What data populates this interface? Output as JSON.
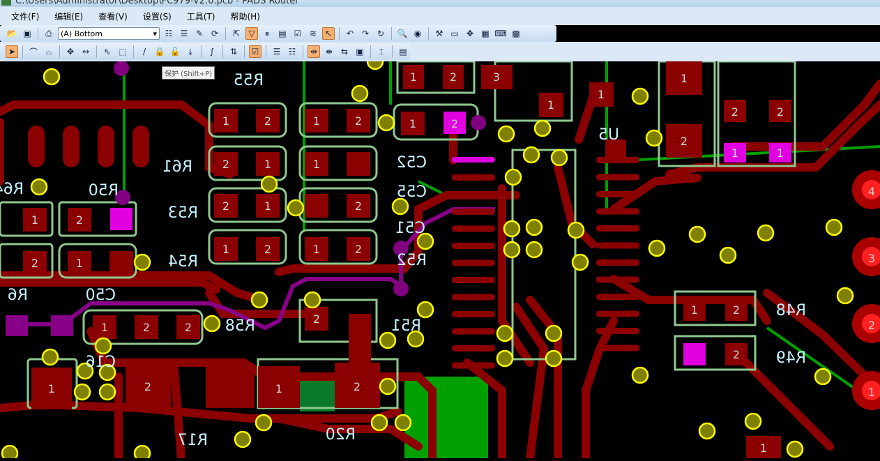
{
  "window": {
    "title": "C:\\Users\\Administrator\\Desktop\\FC979-V2.0.pcb  - PADS Router"
  },
  "menu": [
    "文件(F)",
    "编辑(E)",
    "查看(V)",
    "设置(S)",
    "工具(T)",
    "帮助(H)"
  ],
  "toolbar": {
    "layer_select": "(A) Bottom",
    "tooltip": "保护 (Shift+P)"
  },
  "silk": {
    "r55": "R55",
    "r61": "R61",
    "r50": "R50",
    "r53": "R53",
    "r54": "R54",
    "r64": "R64",
    "c52": "C52",
    "c55": "C55",
    "c51": "C51",
    "r52": "R52",
    "c50": "C50",
    "r58": "R58",
    "r51": "R51",
    "c16": "C16",
    "r17": "R17",
    "r20": "R20",
    "r48": "R48",
    "r49": "R49",
    "u5": "U5",
    "r6": "R6"
  },
  "pins": {
    "p1": "1",
    "p2": "2",
    "p3": "3",
    "p4": "4"
  },
  "colors": {
    "trace": "#8b0000",
    "via": "#808000",
    "pad_outline": "#90c890",
    "plane": "#00a000",
    "highlight": "#e000e0"
  }
}
